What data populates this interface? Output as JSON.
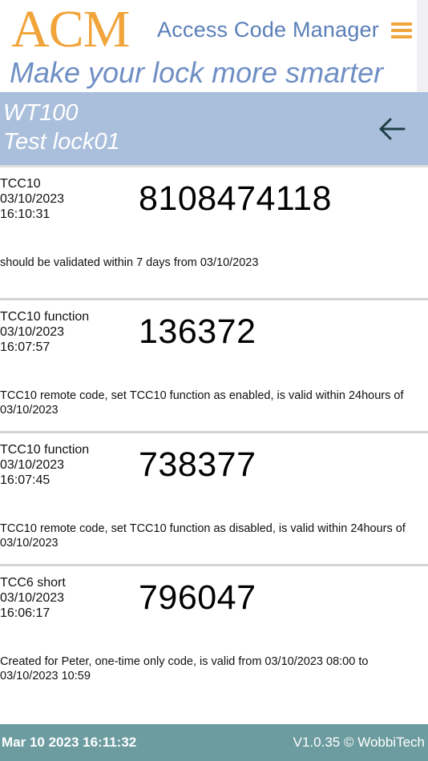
{
  "header": {
    "logo": "ACM",
    "app_name": "Access Code Manager",
    "tagline": "Make your lock more smarter",
    "menu_icon": "hamburger-menu-icon"
  },
  "lock": {
    "model": "WT100",
    "name": "Test lock01",
    "back_icon": "arrow-left-icon"
  },
  "codes": [
    {
      "title": "TCC10",
      "date": "03/10/2023",
      "time": "16:10:31",
      "code": "8108474118",
      "description": "should be validated within 7 days from 03/10/2023"
    },
    {
      "title": "TCC10 function",
      "date": "03/10/2023",
      "time": "16:07:57",
      "code": "136372",
      "description": "TCC10 remote code, set TCC10 function as enabled, is valid within 24hours of 03/10/2023"
    },
    {
      "title": "TCC10 function",
      "date": "03/10/2023",
      "time": "16:07:45",
      "code": "738377",
      "description": "TCC10 remote code, set TCC10 function as disabled, is valid within 24hours of 03/10/2023"
    },
    {
      "title": "TCC6 short",
      "date": "03/10/2023",
      "time": "16:06:17",
      "code": "796047",
      "description": "Created for Peter, one-time only code, is valid from 03/10/2023 08:00 to 03/10/2023 10:59"
    }
  ],
  "footer": {
    "datetime": "Mar 10 2023 16:11:32",
    "version": "V1.0.35 © WobbiTech"
  },
  "colors": {
    "brand_orange": "#f0a43a",
    "title_blue": "#5a7fb8",
    "lock_bar": "#aabfdb",
    "footer": "#6c9c9f"
  }
}
